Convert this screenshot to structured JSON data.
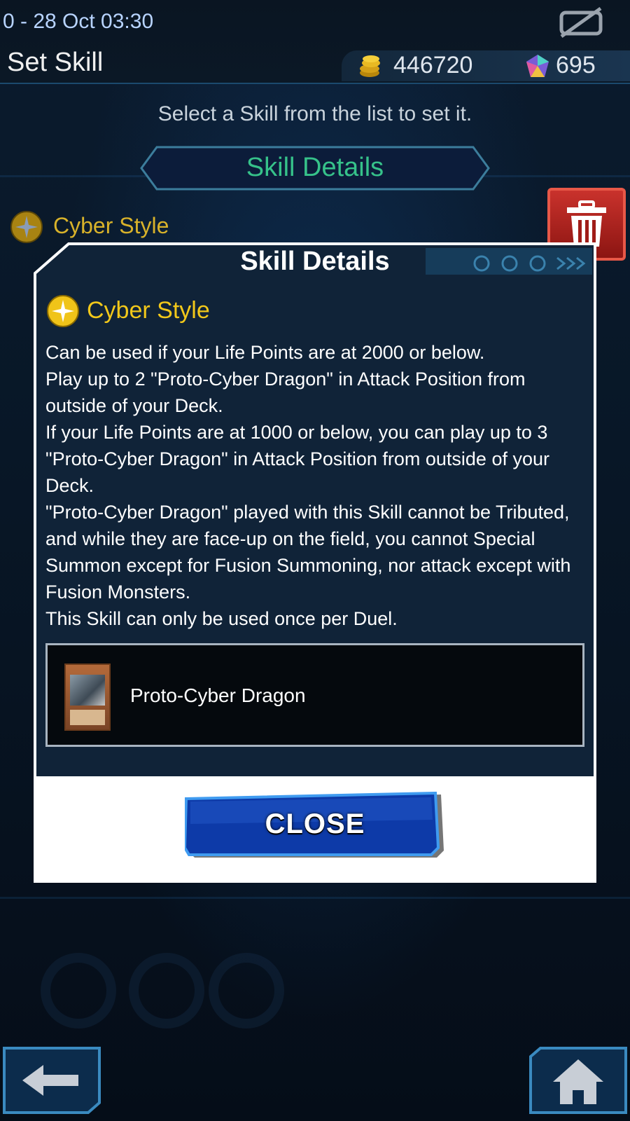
{
  "status_bar": {
    "datetime": "0 - 28 Oct 03:30"
  },
  "header": {
    "title": "Set Skill",
    "coins": "446720",
    "gems": "695"
  },
  "main": {
    "instruction": "Select a Skill from the list to set it.",
    "banner_label": "Skill Details",
    "selected_skill": "Cyber Style"
  },
  "modal": {
    "title": "Skill Details",
    "skill_name": "Cyber Style",
    "description": "Can be used if your Life Points are at 2000 or below.\nPlay up to 2 \"Proto-Cyber Dragon\" in Attack Position from outside of your Deck.\nIf your Life Points are at 1000 or below, you can play up to 3 \"Proto-Cyber Dragon\" in Attack Position from outside of your Deck.\n\"Proto-Cyber Dragon\" played with this Skill cannot be Tributed, and while they are face-up on the field, you cannot Special Summon except for Fusion Summoning, nor attack except with Fusion Monsters.\nThis Skill can only be used once per Duel.",
    "related_card": "Proto-Cyber Dragon",
    "close_label": "CLOSE"
  },
  "icons": {
    "no_signal": "no-signal-icon",
    "coin": "coin-icon",
    "gem": "gem-icon",
    "skill": "skill-star-icon",
    "trash": "trash-icon",
    "back": "back-arrow-icon",
    "home": "home-icon"
  },
  "colors": {
    "accent_green": "#36c28a",
    "skill_gold": "#f2c81a",
    "button_blue": "#0d3aa8",
    "trash_red": "#c9322c"
  }
}
